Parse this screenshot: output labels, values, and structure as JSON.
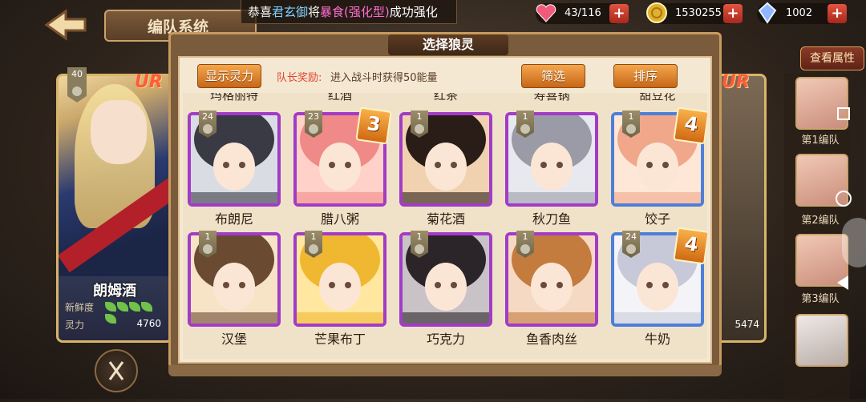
{
  "header": {
    "team_title": "编队系统",
    "marquee": {
      "prefix": "恭喜",
      "player": "君玄御",
      "mid": "将",
      "item": "暴食(强化型)",
      "suffix": "成功强化"
    }
  },
  "resources": {
    "hp": {
      "value": "43/116",
      "icon": "heart-icon",
      "color": "#f25a7a"
    },
    "gold": {
      "value": "1530255",
      "icon": "coin-icon",
      "color": "#e0b02e"
    },
    "gem": {
      "value": "1002",
      "icon": "crystal-icon",
      "color": "#8fb6ff"
    }
  },
  "view_attributes_label": "查看属性",
  "left_card": {
    "rarity": "UR",
    "level": "40",
    "name": "朗姆酒",
    "freshness_label": "新鲜度",
    "power_label": "灵力",
    "power_value": "4760"
  },
  "right_card": {
    "rarity": "UR",
    "power_value": "5474"
  },
  "team_sidebar": [
    {
      "label": "第1编队"
    },
    {
      "label": "第2编队"
    },
    {
      "label": "第3编队"
    },
    {
      "label": ""
    }
  ],
  "modal": {
    "title": "选择狼灵",
    "show_power_label": "显示灵力",
    "captain_label": "队长奖励:",
    "captain_text": "进入战斗时获得50能量",
    "filter_label": "筛选",
    "sort_label": "排序"
  },
  "peek_names": [
    "玛格丽特",
    "红酒",
    "红茶",
    "寿喜锅",
    "甜豆花"
  ],
  "cards": [
    {
      "name": "布朗尼",
      "level": "24",
      "stars": "",
      "frame": "purple",
      "colors": [
        "#d9dde3",
        "#3a3a44"
      ]
    },
    {
      "name": "腊八粥",
      "level": "23",
      "stars": "3",
      "frame": "purple",
      "colors": [
        "#ffd1c9",
        "#f08a88"
      ]
    },
    {
      "name": "菊花酒",
      "level": "1",
      "stars": "",
      "frame": "purple",
      "colors": [
        "#f0d2b0",
        "#2a1c16"
      ]
    },
    {
      "name": "秋刀鱼",
      "level": "1",
      "stars": "",
      "frame": "purple",
      "colors": [
        "#e7e9ef",
        "#9a9ba6"
      ]
    },
    {
      "name": "饺子",
      "level": "1",
      "stars": "4",
      "frame": "blue",
      "colors": [
        "#ffe7d8",
        "#f1a78a"
      ]
    },
    {
      "name": "汉堡",
      "level": "1",
      "stars": "",
      "frame": "purple",
      "colors": [
        "#f7e3c6",
        "#6b4a32"
      ]
    },
    {
      "name": "芒果布丁",
      "level": "1",
      "stars": "",
      "frame": "purple",
      "colors": [
        "#ffe7a0",
        "#f0b830"
      ]
    },
    {
      "name": "巧克力",
      "level": "1",
      "stars": "",
      "frame": "purple",
      "colors": [
        "#c9c2c6",
        "#2b2428"
      ]
    },
    {
      "name": "鱼香肉丝",
      "level": "1",
      "stars": "",
      "frame": "purple",
      "colors": [
        "#f6d9c2",
        "#c47b3e"
      ]
    },
    {
      "name": "牛奶",
      "level": "24",
      "stars": "4",
      "frame": "blue",
      "colors": [
        "#f4f4f8",
        "#c7c9d8"
      ]
    }
  ]
}
